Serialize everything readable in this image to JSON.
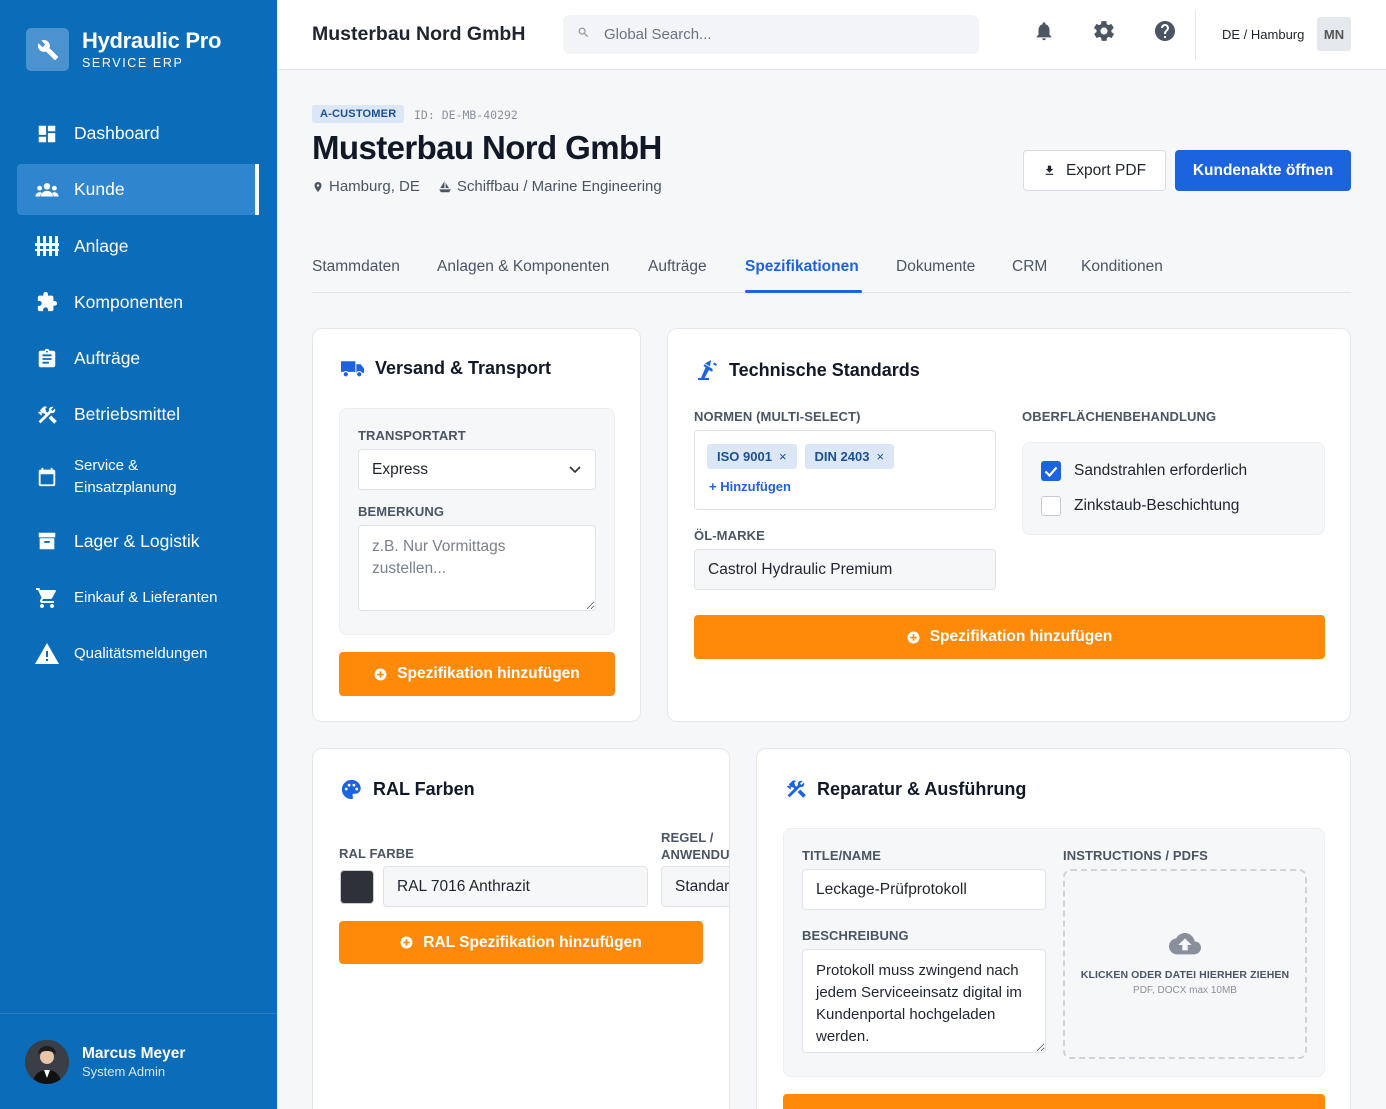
{
  "brand": {
    "name": "Hydraulic Pro",
    "subtitle": "SERVICE ERP"
  },
  "sidebar": {
    "items": [
      {
        "label": "Dashboard",
        "icon": "dashboard-icon"
      },
      {
        "label": "Kunde",
        "icon": "users-icon",
        "active": true
      },
      {
        "label": "Anlage",
        "icon": "plant-icon"
      },
      {
        "label": "Komponenten",
        "icon": "puzzle-icon"
      },
      {
        "label": "Aufträge",
        "icon": "clipboard-icon"
      },
      {
        "label": "Betriebsmittel",
        "icon": "tools-icon"
      },
      {
        "label": "Service & Einsatzplanung",
        "icon": "calendar-icon"
      },
      {
        "label": "Lager & Logistik",
        "icon": "archive-icon"
      },
      {
        "label": "Einkauf & Lieferanten",
        "icon": "cart-icon"
      },
      {
        "label": "Qualitätsmeldungen",
        "icon": "warning-icon"
      }
    ],
    "user": {
      "name": "Marcus Meyer",
      "role": "System Admin"
    }
  },
  "topbar": {
    "title": "Musterbau Nord GmbH",
    "search_placeholder": "Global Search...",
    "locale": "DE / Hamburg",
    "initials": "MN"
  },
  "customer": {
    "tag": "A-CUSTOMER",
    "id": "ID: DE-MB-40292",
    "name": "Musterbau Nord GmbH",
    "location": "Hamburg, DE",
    "industry": "Schiffbau / Marine Engineering",
    "export_label": "Export PDF",
    "open_label": "Kundenakte öffnen"
  },
  "tabs": [
    "Stammdaten",
    "Anlagen & Komponenten",
    "Aufträge",
    "Spezifikationen",
    "Dokumente",
    "CRM",
    "Konditionen"
  ],
  "active_tab": "Spezifikationen",
  "versand": {
    "title": "Versand & Transport",
    "transport_label": "TRANSPORTART",
    "transport_value": "Express",
    "remark_label": "BEMERKUNG",
    "remark_placeholder": "z.B. Nur Vormittags zustellen...",
    "button": "Spezifikation hinzufügen"
  },
  "technik": {
    "title": "Technische Standards",
    "norms_label": "NORMEN (MULTI-SELECT)",
    "norms": [
      "ISO 9001",
      "DIN 2403"
    ],
    "add_norm": "+ Hinzufügen",
    "oil_label": "ÖL-MARKE",
    "oil_value": "Castrol Hydraulic Premium",
    "surface_label": "OBERFLÄCHENBEHANDLUNG",
    "surface_options": [
      {
        "label": "Sandstrahlen erforderlich",
        "checked": true
      },
      {
        "label": "Zinkstaub-Beschichtung",
        "checked": false
      }
    ],
    "button": "Spezifikation hinzufügen"
  },
  "ral": {
    "title": "RAL Farben",
    "color_label": "RAL FARBE",
    "rule_label_1": "REGEL /",
    "rule_label_2": "ANWENDUNG",
    "color_value": "RAL 7016 Anthrazit",
    "swatch": "#2e3238",
    "rule_value": "Standard",
    "button": "RAL Spezifikation hinzufügen"
  },
  "reparatur": {
    "title": "Reparatur & Ausführung",
    "name_label": "TITLE/NAME",
    "name_value": "Leckage-Prüfprotokoll",
    "desc_label": "BESCHREIBUNG",
    "desc_value": "Protokoll muss zwingend nach jedem Serviceeinsatz digital im Kundenportal hochgeladen werden.",
    "pdf_label": "INSTRUCTIONS / PDFS",
    "drop_main": "KLICKEN ODER DATEI HIERHER ZIEHEN",
    "drop_sub": "PDF, DOCX max 10MB"
  },
  "colors": {
    "sidebar": "#0b6cba",
    "primary": "#1c63e0",
    "accent": "#ff8a0a"
  }
}
